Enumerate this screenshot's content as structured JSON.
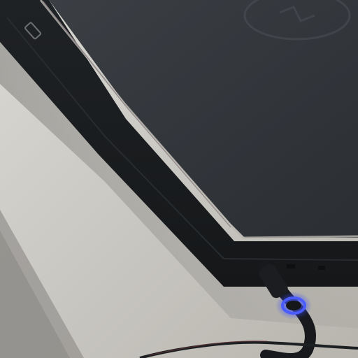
{
  "scene": {
    "kind": "photo",
    "subject": "laptop-corner-with-charging-cable",
    "colors": {
      "table": "#d3d1cb",
      "table_shadow": "#8f8d89",
      "laptop_lid": "#34383c",
      "laptop_edge": "#1c1e21",
      "laptop_highlight": "#b9b6b0",
      "cable": "#17191c",
      "led": "#3d4dff"
    },
    "icons": {
      "logo": "dell-logo-icon",
      "drive_mark": "optical-drive-icon",
      "indicator": "power-led-icon"
    }
  }
}
